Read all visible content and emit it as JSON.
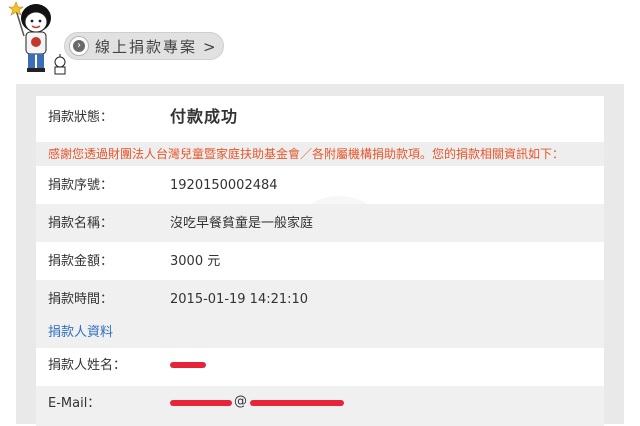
{
  "header": {
    "breadcrumb_label": "線上捐款專案",
    "breadcrumb_arrow": ">",
    "breadcrumb_icon": "›"
  },
  "receipt": {
    "status_label": "捐款狀態：",
    "status_value": "付款成功",
    "notice": "感謝您透過財團法人台灣兒童暨家庭扶助基金會／各附屬機構捐助款項。您的捐款相關資訊如下：",
    "rows": [
      {
        "label": "捐款序號：",
        "value": "1920150002484"
      },
      {
        "label": "捐款名稱：",
        "value": "沒吃早餐貧童是一般家庭"
      },
      {
        "label": "捐款金額：",
        "value": "3000 元"
      },
      {
        "label": "捐款時間：",
        "value": "2015-01-19 14:21:10"
      }
    ]
  },
  "donor": {
    "section_title": "捐款人資料",
    "name_label": "捐款人姓名：",
    "email_label": "E-Mail：",
    "email_at": "@"
  },
  "colors": {
    "success": "#2e8b23",
    "notice": "#e8562b",
    "section": "#2f6fbf",
    "redaction": "#e6243a"
  }
}
